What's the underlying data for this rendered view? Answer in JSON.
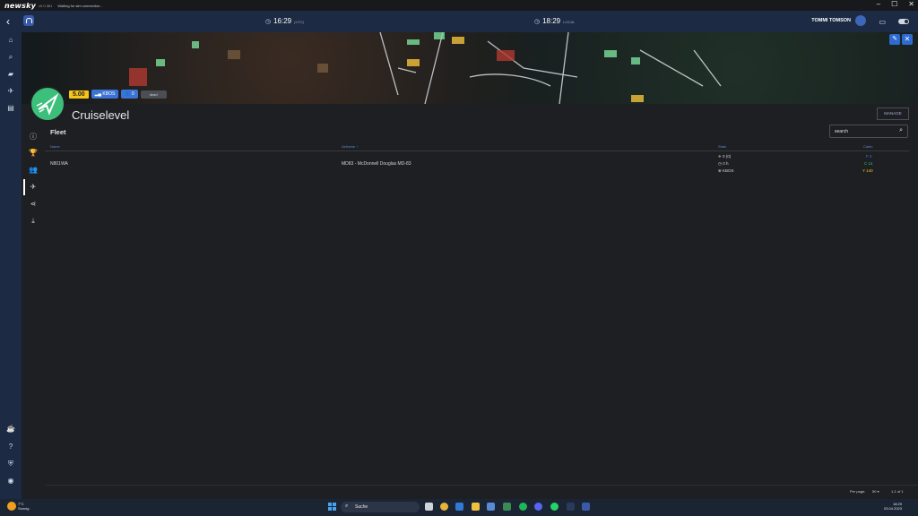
{
  "titlebar": {
    "brand": "newsky",
    "version": "v0.0.361",
    "status": "Waiting for sim connection..."
  },
  "topbar": {
    "utc_time": "16:29",
    "utc_label": "(UTC)",
    "local_time": "18:29",
    "local_label": "LOCAL",
    "user_name": "TOMMI TOMSON"
  },
  "org": {
    "score": "5.00",
    "base_badge": "KBOS",
    "members_badge": "0",
    "grey_badge": "dead",
    "name": "Cruiselevel",
    "manage_label": "MANAGE"
  },
  "fleet": {
    "title": "Fleet",
    "search_placeholder": "search",
    "columns": {
      "name": "Name",
      "airframe": "Airframe",
      "stats": "Stats",
      "cabin": "Cabin"
    },
    "sort_indicator": "↑",
    "rows": [
      {
        "name": "N801WA",
        "airframe": "MD83 - McDonnell Douglas MD-83",
        "stat_flights": "0 (0)",
        "stat_hours": "0 h",
        "stat_location": "KBOS",
        "cabin_f": "F 0",
        "cabin_c": "C 14",
        "cabin_y": "Y 140"
      }
    ]
  },
  "pagination": {
    "per_page_label": "Per page:",
    "per_page_value": "50",
    "range": "1-1 of 1"
  },
  "taskbar": {
    "weather_temp": "7°C",
    "weather_desc": "Sonnig",
    "search_label": "Suche",
    "clock_time": "18:29",
    "clock_date": "03.04.2023"
  },
  "colors": {
    "accent": "#3b73d6",
    "score": "#f5c518",
    "cabin_f": "#3b73d6",
    "cabin_c": "#3bbf7a",
    "cabin_y": "#f5c518",
    "logo": "#3bbf7a"
  }
}
